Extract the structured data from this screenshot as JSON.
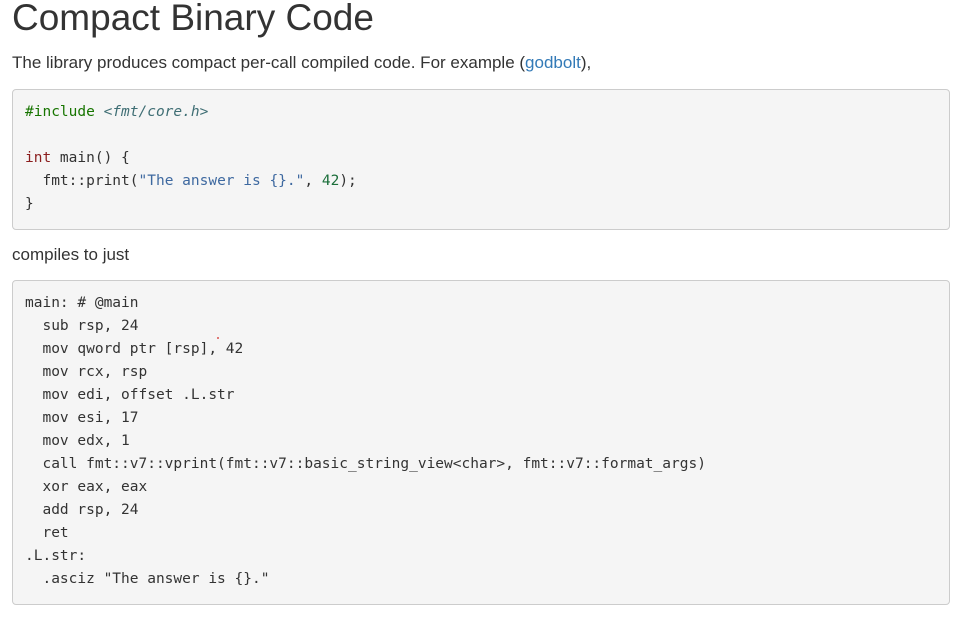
{
  "page": {
    "title": "Compact Binary Code",
    "intro_before": "The library produces compact per-call compiled code. For example (",
    "intro_link": "godbolt",
    "intro_after": "),",
    "mid_text": "compiles to just"
  },
  "cpp_code": {
    "include_directive": "#include",
    "include_path": "<fmt/core.h>",
    "main_type": "int",
    "main_rest": " main() {",
    "print_call": "  fmt::print(",
    "print_string": "\"The answer is {}.\"",
    "print_sep": ", ",
    "print_number": "42",
    "print_end": ");",
    "closing_brace": "}"
  },
  "asm_code": {
    "lines": [
      "main: # @main",
      "  sub rsp, 24",
      "  mov qword ptr [rsp], 42",
      "  mov rcx, rsp",
      "  mov edi, offset .L.str",
      "  mov esi, 17",
      "  mov edx, 1",
      "  call fmt::v7::vprint(fmt::v7::basic_string_view<char>, fmt::v7::format_args)",
      "  xor eax, eax",
      "  add rsp, 24",
      "  ret",
      ".L.str:",
      "  .asciz \"The answer is {}.\""
    ]
  },
  "colors": {
    "link": "#337ab7",
    "code_background": "#f5f5f5",
    "code_border": "#cccccc",
    "text": "#333333"
  }
}
